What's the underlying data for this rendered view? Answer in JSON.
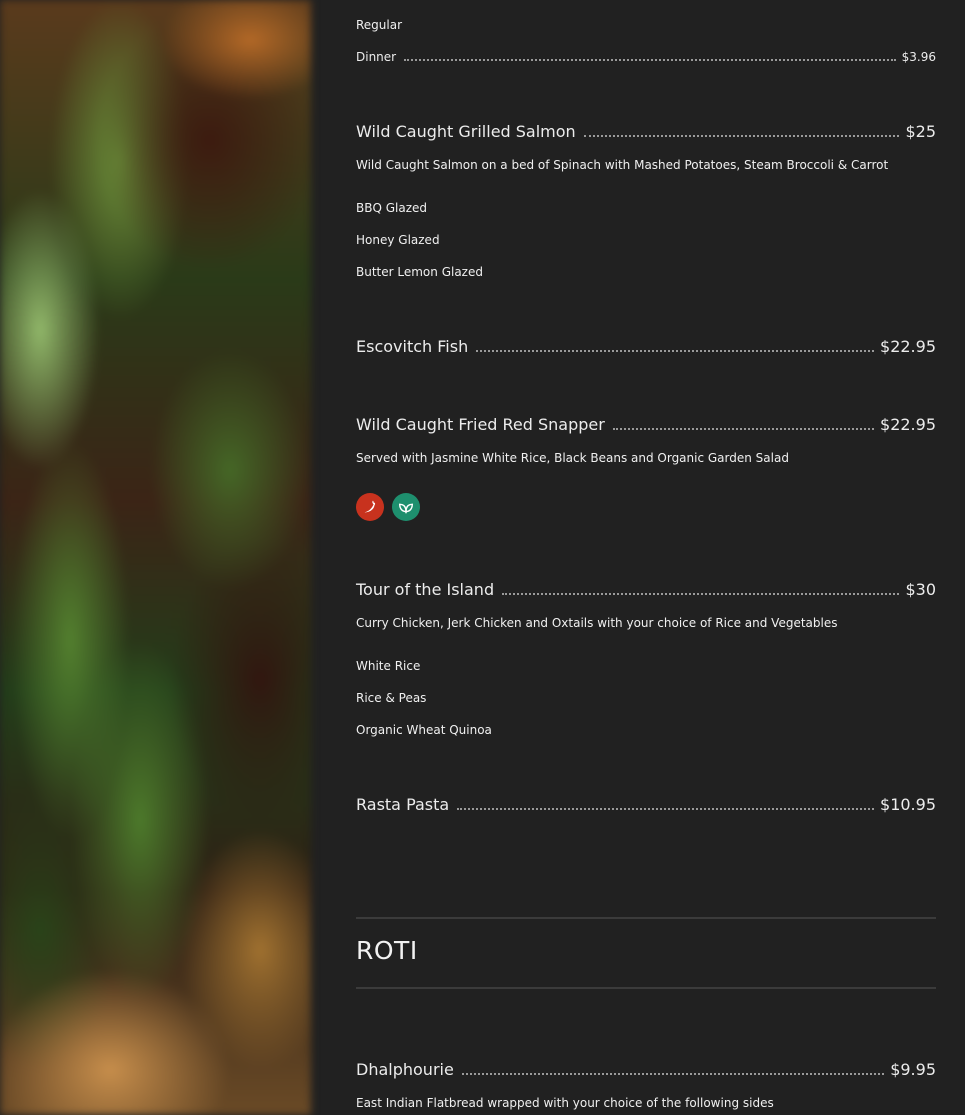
{
  "colors": {
    "background": "#212121",
    "spicy_badge": "#c8321e",
    "vegan_badge": "#1e8f6e"
  },
  "menu": {
    "beverage": {
      "option_regular": "Regular",
      "option_dinner": "Dinner",
      "dinner_price": "$3.96"
    },
    "salmon": {
      "name": "Wild Caught Grilled Salmon",
      "price": "$25",
      "description": "Wild Caught Salmon on a bed of Spinach with Mashed Potatoes, Steam Broccoli & Carrot",
      "options": [
        "BBQ Glazed",
        "Honey Glazed",
        "Butter Lemon Glazed"
      ]
    },
    "escovitch": {
      "name": "Escovitch Fish",
      "price": "$22.95"
    },
    "snapper": {
      "name": "Wild Caught Fried Red Snapper",
      "price": "$22.95",
      "description": "Served with Jasmine White Rice, Black Beans and Organic Garden Salad",
      "badges": [
        "chili-pepper-icon",
        "vegan-leaf-icon"
      ]
    },
    "tour": {
      "name": "Tour of the Island",
      "price": "$30",
      "description": "Curry Chicken, Jerk Chicken and Oxtails with your choice of Rice and Vegetables",
      "options": [
        "White Rice",
        "Rice & Peas",
        "Organic Wheat Quinoa"
      ]
    },
    "pasta": {
      "name": "Rasta Pasta",
      "price": "$10.95"
    },
    "roti_section": {
      "title": "ROTI"
    },
    "dhalphourie": {
      "name": "Dhalphourie",
      "price": "$9.95",
      "description": "East Indian Flatbread wrapped with your choice of the following sides"
    }
  }
}
